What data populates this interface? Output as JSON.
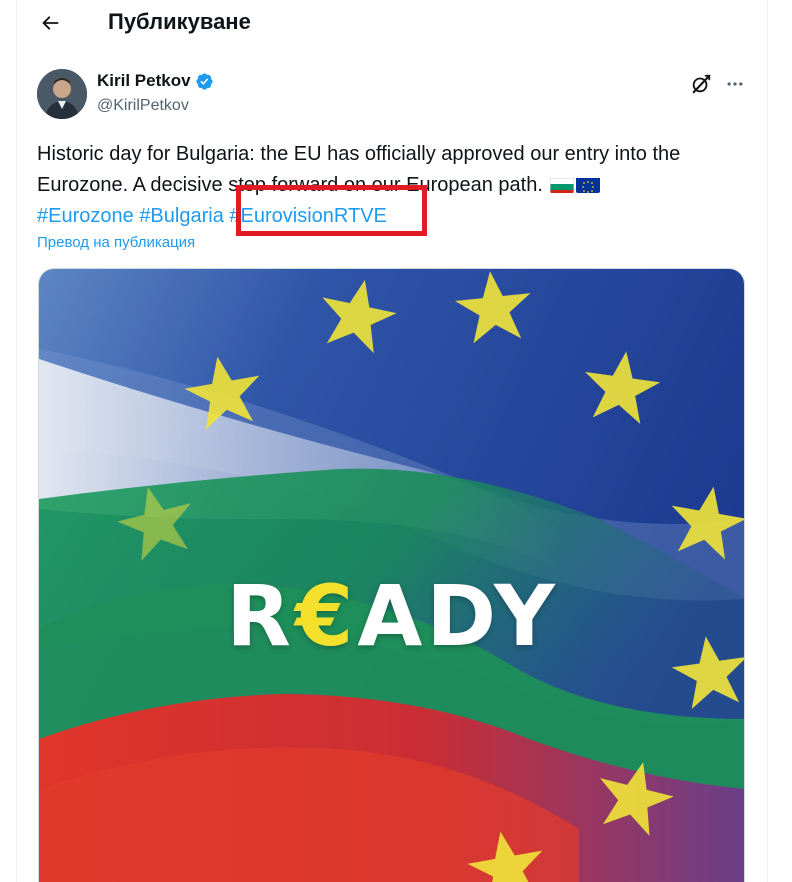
{
  "header": {
    "title": "Публикуване"
  },
  "post": {
    "author": {
      "display_name": "Kiril Petkov",
      "handle": "@KirilPetkov",
      "verified": true
    },
    "text_line1": "Historic day for Bulgaria: the EU has officially approved our entry into the",
    "text_line2": "Eurozone. A decisive step forward on our European path. ",
    "hashtags": [
      "#Eurozone",
      "#Bulgaria",
      "#EurovisionRTVE"
    ],
    "flags": [
      "bulgaria-flag",
      "eu-flag"
    ],
    "translate_label": "Превод на публикация",
    "media": {
      "word_prefix": "R",
      "word_euro": "€",
      "word_suffix": "ADY"
    }
  },
  "colors": {
    "link": "#1d9bf0",
    "verified": "#1d9bf0",
    "highlight": "#e01b24",
    "euro_yellow": "#f5e12b"
  }
}
